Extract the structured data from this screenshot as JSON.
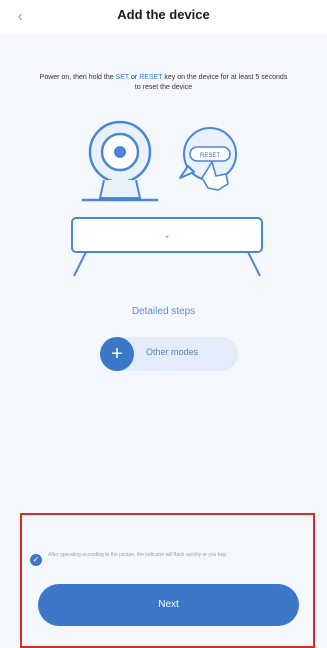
{
  "header": {
    "title": "Add the device",
    "back_icon": "chevron-left-icon"
  },
  "instruction": {
    "prefix": "Power on, then hold the ",
    "key1": "SET",
    "or": " or ",
    "key2": "RESET",
    "suffix": " key on the device for at least 5 seconds to reset the device"
  },
  "illustration": {
    "button_label": "RESET"
  },
  "detailed_steps": "Detailed steps",
  "other_modes": {
    "label": "Other modes",
    "icon": "plus-icon"
  },
  "confirm": {
    "text": "After operating according to the picture, the indicator will flash quickly or you hop",
    "checked": true
  },
  "next_button": "Next",
  "colors": {
    "accent": "#3d77c8",
    "highlight_border": "#d42b2b",
    "illustration_stroke": "#4a86d8"
  }
}
